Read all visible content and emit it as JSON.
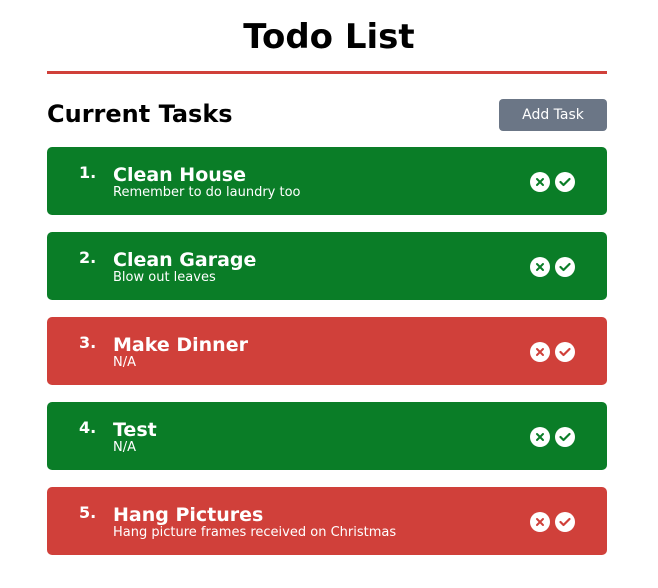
{
  "header": {
    "title": "Todo List"
  },
  "section": {
    "heading": "Current Tasks",
    "add_button_label": "Add Task"
  },
  "colors": {
    "accent_rule": "#d0403a",
    "done": "#0a7d27",
    "pending": "#d0403a",
    "button": "#6b7686"
  },
  "tasks": [
    {
      "number": "1.",
      "title": "Clean House",
      "description": "Remember to do laundry too",
      "status": "done"
    },
    {
      "number": "2.",
      "title": "Clean Garage",
      "description": "Blow out leaves",
      "status": "done"
    },
    {
      "number": "3.",
      "title": "Make Dinner",
      "description": "N/A",
      "status": "pending"
    },
    {
      "number": "4.",
      "title": "Test",
      "description": "N/A",
      "status": "done"
    },
    {
      "number": "5.",
      "title": "Hang Pictures",
      "description": "Hang picture frames received on Christmas",
      "status": "pending"
    }
  ],
  "icons": {
    "delete": "close-circle-icon",
    "complete": "check-circle-icon"
  }
}
